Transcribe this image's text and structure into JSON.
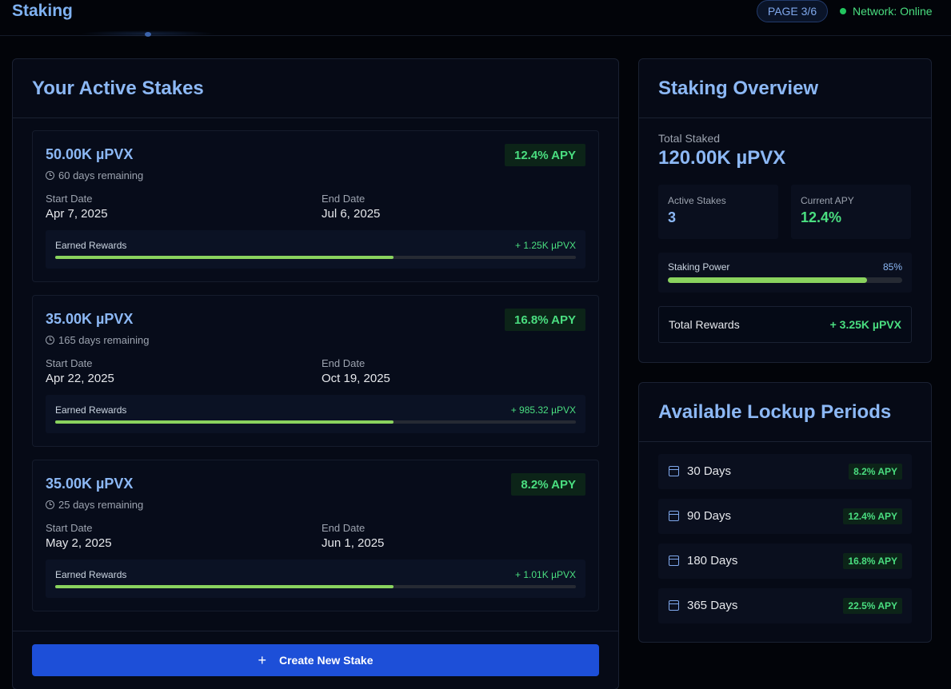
{
  "header": {
    "title": "Staking",
    "page_indicator": "PAGE 3/6",
    "network_status": "Network: Online"
  },
  "active_stakes": {
    "title": "Your Active Stakes",
    "stakes": [
      {
        "amount": "50.00K µPVX",
        "remaining": "60 days remaining",
        "apy": "12.4% APY",
        "start_label": "Start Date",
        "start": "Apr 7, 2025",
        "end_label": "End Date",
        "end": "Jul 6, 2025",
        "rewards_label": "Earned Rewards",
        "rewards": "+ 1.25K µPVX",
        "progress": 0.65
      },
      {
        "amount": "35.00K µPVX",
        "remaining": "165 days remaining",
        "apy": "16.8% APY",
        "start_label": "Start Date",
        "start": "Apr 22, 2025",
        "end_label": "End Date",
        "end": "Oct 19, 2025",
        "rewards_label": "Earned Rewards",
        "rewards": "+ 985.32 µPVX",
        "progress": 0.65
      },
      {
        "amount": "35.00K µPVX",
        "remaining": "25 days remaining",
        "apy": "8.2% APY",
        "start_label": "Start Date",
        "start": "May 2, 2025",
        "end_label": "End Date",
        "end": "Jun 1, 2025",
        "rewards_label": "Earned Rewards",
        "rewards": "+ 1.01K µPVX",
        "progress": 0.65
      }
    ],
    "create_label": "Create New Stake",
    "create_icon": "+"
  },
  "overview": {
    "title": "Staking Overview",
    "total_staked_label": "Total Staked",
    "total_staked": "120.00K µPVX",
    "active_stakes_label": "Active Stakes",
    "active_stakes": "3",
    "current_apy_label": "Current APY",
    "current_apy": "12.4%",
    "power_label": "Staking Power",
    "power_value": "85%",
    "power_fraction": 0.85,
    "total_rewards_label": "Total Rewards",
    "total_rewards": "+ 3.25K µPVX"
  },
  "lockups": {
    "title": "Available Lockup Periods",
    "items": [
      {
        "label": "30 Days",
        "apy": "8.2% APY"
      },
      {
        "label": "90 Days",
        "apy": "12.4% APY"
      },
      {
        "label": "180 Days",
        "apy": "16.8% APY"
      },
      {
        "label": "365 Days",
        "apy": "22.5% APY"
      }
    ]
  },
  "colors": {
    "accent": "#8cb8f5",
    "positive": "#4ade80",
    "progress": "#8ad35e",
    "button": "#1d4fd8"
  }
}
